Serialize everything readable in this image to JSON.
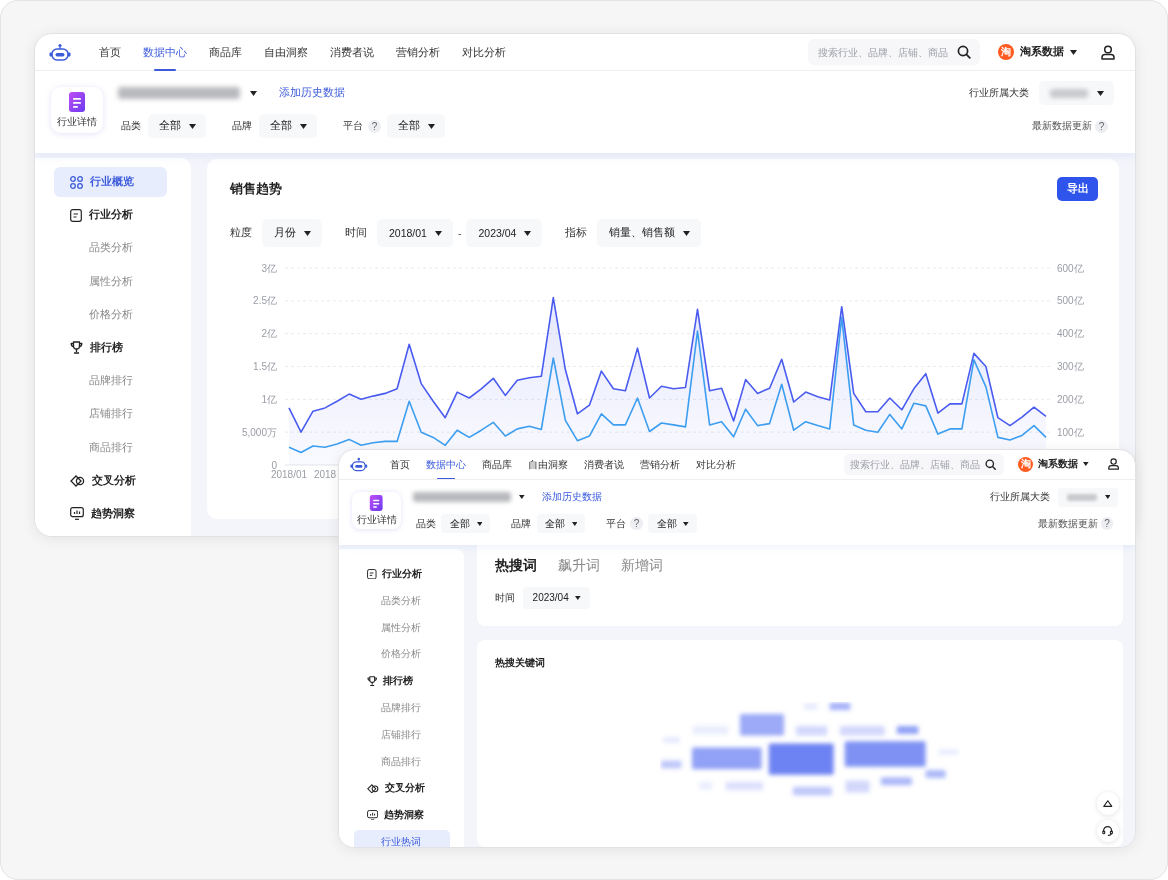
{
  "windows": [
    {
      "kind": "overview",
      "nav": {
        "items": [
          {
            "label": "首页",
            "selected": false
          },
          {
            "label": "数据中心",
            "selected": true
          },
          {
            "label": "商品库",
            "selected": false
          },
          {
            "label": "自由洞察",
            "selected": false
          },
          {
            "label": "消费者说",
            "selected": false
          },
          {
            "label": "营销分析",
            "selected": false
          },
          {
            "label": "对比分析",
            "selected": false
          }
        ],
        "search_placeholder": "搜索行业、品牌、店铺、商品",
        "platform": {
          "badge": "淘",
          "label": "淘系数据"
        }
      },
      "header": {
        "badge_label": "行业详情",
        "link": "添加历史数据",
        "category_label": "行业所属大类",
        "filters": [
          {
            "label": "品类",
            "value": "全部"
          },
          {
            "label": "品牌",
            "value": "全部"
          },
          {
            "label": "平台",
            "hint": "?",
            "value": "全部"
          }
        ],
        "update_label": "最新数据更新",
        "update_hint": "?"
      },
      "sidebar": [
        {
          "label": "行业概览",
          "kind": "grid",
          "selected": true
        },
        {
          "label": "行业分析",
          "kind": "doc",
          "selected": false,
          "children": [
            {
              "label": "品类分析",
              "selected": false
            },
            {
              "label": "属性分析",
              "selected": false
            },
            {
              "label": "价格分析",
              "selected": false
            }
          ]
        },
        {
          "label": "排行榜",
          "kind": "trophy",
          "selected": false,
          "children": [
            {
              "label": "品牌排行",
              "selected": false
            },
            {
              "label": "店铺排行",
              "selected": false
            },
            {
              "label": "商品排行",
              "selected": false
            }
          ]
        },
        {
          "label": "交叉分析",
          "kind": "cross",
          "selected": false
        },
        {
          "label": "趋势洞察",
          "kind": "screen",
          "selected": false
        }
      ],
      "card": {
        "title": "销售趋势",
        "export": "导出",
        "controls": [
          {
            "label": "粒度",
            "options": [
              "月份"
            ]
          },
          {
            "label": "时间",
            "options": [
              "2018/01",
              "2023/04"
            ],
            "separator": "-"
          },
          {
            "label": "指标",
            "options": [
              "销量、销售额"
            ]
          }
        ],
        "chart_data": {
          "type": "area",
          "grid": true,
          "ylim": [
            0,
            3
          ],
          "yticks": [
            {
              "value": 0,
              "label": "0"
            },
            {
              "value": 1,
              "label": "1亿"
            },
            {
              "value": 1.5,
              "label": "1.5亿"
            },
            {
              "value": 2,
              "label": "2亿"
            },
            {
              "value": 2.5,
              "label": "2.5亿"
            },
            {
              "value": 3,
              "label": "3亿"
            }
          ],
          "series": [
            {
              "color": "#4a5cf0",
              "values": [
                0.87,
                0.5,
                0.82,
                0.87,
                0.97,
                1.08,
                1.0,
                1.05,
                1.09,
                1.16,
                1.84,
                1.24,
                0.97,
                0.72,
                1.11,
                1.02,
                1.16,
                1.32,
                1.06,
                1.29,
                1.33,
                1.35,
                2.55,
                1.45,
                0.78,
                0.91,
                1.43,
                1.16,
                1.13,
                1.78,
                1.02,
                1.2,
                1.16,
                1.18,
                2.37,
                1.13,
                1.17,
                0.67,
                1.3,
                1.09,
                1.17,
                1.61,
                0.96,
                1.11,
                1.04,
                0.99,
                2.41,
                1.09,
                0.81,
                0.81,
                1.02,
                0.84,
                1.16,
                1.39,
                0.79,
                0.93,
                0.93,
                1.7,
                1.5,
                0.72,
                0.6,
                0.73,
                0.88,
                0.74
              ]
            },
            {
              "color": "#3d9ef0",
              "type": "line",
              "values": [
                0.27,
                0.19,
                0.29,
                0.27,
                0.32,
                0.39,
                0.3,
                0.34,
                0.36,
                0.36,
                0.97,
                0.5,
                0.42,
                0.3,
                0.53,
                0.42,
                0.53,
                0.65,
                0.44,
                0.55,
                0.59,
                0.54,
                1.63,
                0.68,
                0.37,
                0.44,
                0.78,
                0.61,
                0.61,
                1.02,
                0.51,
                0.64,
                0.61,
                0.58,
                2.04,
                0.61,
                0.66,
                0.43,
                0.85,
                0.6,
                0.63,
                1.23,
                0.53,
                0.66,
                0.6,
                0.55,
                2.25,
                0.61,
                0.53,
                0.5,
                0.77,
                0.55,
                0.94,
                0.9,
                0.47,
                0.55,
                0.55,
                1.6,
                1.19,
                0.42,
                0.38,
                0.45,
                0.6,
                0.42
              ]
            }
          ]
        },
        "x_axis_labels": [
          "2018/01",
          "2018"
        ],
        "half_tick_label": "5,000万",
        "right_axis_labels": [
          "600亿",
          "500亿",
          "400亿",
          "300亿",
          "200亿",
          "100亿"
        ]
      }
    },
    {
      "kind": "hot_words",
      "nav": {
        "items": [
          {
            "label": "首页",
            "selected": false
          },
          {
            "label": "数据中心",
            "selected": true
          },
          {
            "label": "商品库",
            "selected": false
          },
          {
            "label": "自由洞察",
            "selected": false
          },
          {
            "label": "消费者说",
            "selected": false
          },
          {
            "label": "营销分析",
            "selected": false
          },
          {
            "label": "对比分析",
            "selected": false
          }
        ],
        "search_placeholder": "搜索行业、品牌、店铺、商品",
        "platform": {
          "badge": "淘",
          "label": "淘系数据"
        }
      },
      "header": {
        "badge_label": "行业详情",
        "link": "添加历史数据",
        "category_label": "行业所属大类",
        "filters": [
          {
            "label": "品类",
            "value": "全部"
          },
          {
            "label": "品牌",
            "value": "全部"
          },
          {
            "label": "平台",
            "hint": "?",
            "value": "全部"
          }
        ],
        "update_label": "最新数据更新",
        "update_hint": "?"
      },
      "sidebar": [
        {
          "label": "行业分析",
          "kind": "doc",
          "selected": false,
          "children": [
            {
              "label": "品类分析",
              "selected": false
            },
            {
              "label": "属性分析",
              "selected": false
            },
            {
              "label": "价格分析",
              "selected": false
            }
          ]
        },
        {
          "label": "排行榜",
          "kind": "trophy",
          "selected": false,
          "children": [
            {
              "label": "品牌排行",
              "selected": false
            },
            {
              "label": "店铺排行",
              "selected": false
            },
            {
              "label": "商品排行",
              "selected": false
            }
          ]
        },
        {
          "label": "交叉分析",
          "kind": "cross",
          "selected": false
        },
        {
          "label": "趋势洞察",
          "kind": "screen",
          "selected": false,
          "children": [
            {
              "label": "行业热词",
              "selected": true
            }
          ]
        }
      ],
      "tabs": [
        {
          "label": "热搜词",
          "selected": true
        },
        {
          "label": "飙升词",
          "selected": false
        },
        {
          "label": "新增词",
          "selected": false
        }
      ],
      "time": {
        "label": "时间",
        "value": "2023/04"
      },
      "keyword_card": {
        "title": "热搜关键词"
      }
    }
  ]
}
